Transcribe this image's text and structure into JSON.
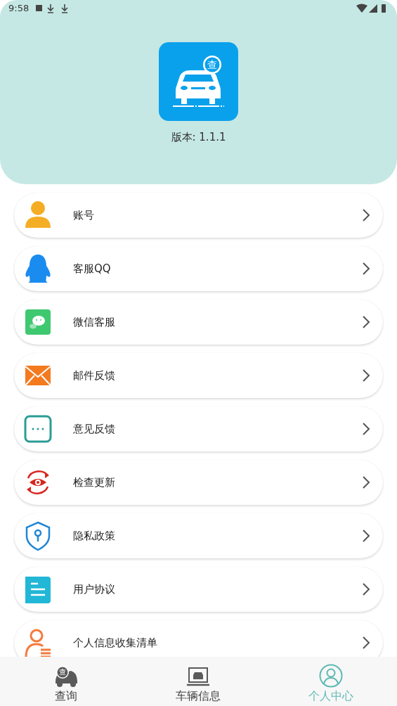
{
  "status_bar": {
    "time": "9:58"
  },
  "header": {
    "logo_badge": "查",
    "version": "版本: 1.1.1"
  },
  "menu": [
    {
      "kind": "account",
      "label": "账号"
    },
    {
      "kind": "qq",
      "label": "客服QQ"
    },
    {
      "kind": "wechat",
      "label": "微信客服"
    },
    {
      "kind": "mail",
      "label": "邮件反馈"
    },
    {
      "kind": "feedback",
      "label": "意见反馈"
    },
    {
      "kind": "update",
      "label": "检查更新"
    },
    {
      "kind": "privacy",
      "label": "隐私政策"
    },
    {
      "kind": "agreement",
      "label": "用户协议"
    },
    {
      "kind": "info_list",
      "label": "个人信息收集清单"
    }
  ],
  "bottom_nav": [
    {
      "kind": "query",
      "label": "查询",
      "badge": "查",
      "selected": false
    },
    {
      "kind": "vehicle",
      "label": "车辆信息",
      "selected": false
    },
    {
      "kind": "profile",
      "label": "个人中心",
      "selected": true
    }
  ]
}
